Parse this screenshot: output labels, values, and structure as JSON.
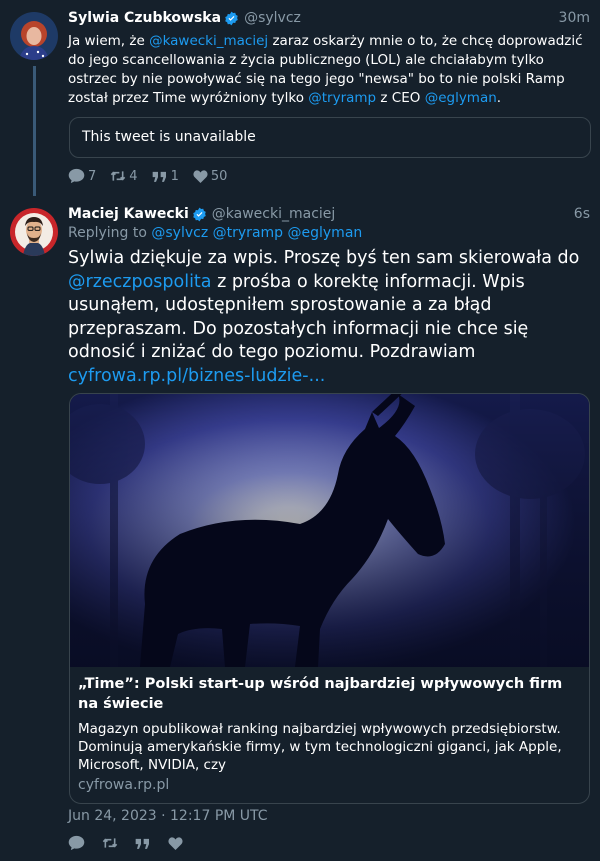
{
  "tweet1": {
    "name": "Sylwia Czubkowska",
    "handle": "@sylvcz",
    "time": "30m",
    "text_parts": [
      {
        "t": "Ja wiem, że ",
        "m": false
      },
      {
        "t": "@kawecki_maciej",
        "m": true
      },
      {
        "t": " zaraz oskarży mnie o to, że chcę doprowadzić do jego scancellowania z życia publicznego (LOL) ale chciałabym tylko ostrzec by nie powoływać się na tego jego \"newsa\" bo to nie polski Ramp został przez Time wyróżniony tylko ",
        "m": false
      },
      {
        "t": "@tryramp",
        "m": true
      },
      {
        "t": " z CEO ",
        "m": false
      },
      {
        "t": "@eglyman",
        "m": true
      },
      {
        "t": ".",
        "m": false
      }
    ],
    "quoted_unavailable": "This tweet is unavailable",
    "counts": {
      "replies": "7",
      "retweets": "4",
      "quotes": "1",
      "likes": "50"
    }
  },
  "tweet2": {
    "name": "Maciej Kawecki",
    "handle": "@kawecki_maciej",
    "time": "6s",
    "replying_prefix": "Replying to ",
    "replying_to": [
      "@sylvcz",
      "@tryramp",
      "@eglyman"
    ],
    "text_parts": [
      {
        "t": "Sylwia dziękuje za wpis. Proszę byś ten sam skierowała do ",
        "m": false
      },
      {
        "t": "@rzeczpospolita",
        "m": true
      },
      {
        "t": " z prośba o korektę informacji. Wpis usunąłem, udostępniłem sprostowanie a za błąd przepraszam. Do pozostałych informacji nie chce się odnosić i zniżać do tego poziomu. Pozdrawiam ",
        "m": false
      },
      {
        "t": "cyfrowa.rp.pl/biznes-ludzie-...",
        "m": true
      }
    ],
    "card": {
      "title": "„Time”: Polski start-up wśród najbardziej wpływowych firm na świecie",
      "description": "Magazyn opublikował ranking najbardziej wpływowych przedsiębiorstw. Dominują amerykańskie firmy, w tym technologiczni giganci, jak Apple, Microsoft, NVIDIA, czy",
      "domain": "cyfrowa.rp.pl"
    },
    "timestamp": "Jun 24, 2023 · 12:17 PM UTC"
  },
  "icons": {
    "reply": "comment-icon",
    "retweet": "retweet-icon",
    "quote": "quote-icon",
    "like": "heart-icon",
    "verified": "verified-badge-icon"
  },
  "colors": {
    "background": "#15202b",
    "link": "#1d9bf0",
    "muted": "#8899a6",
    "border": "#38444d"
  }
}
